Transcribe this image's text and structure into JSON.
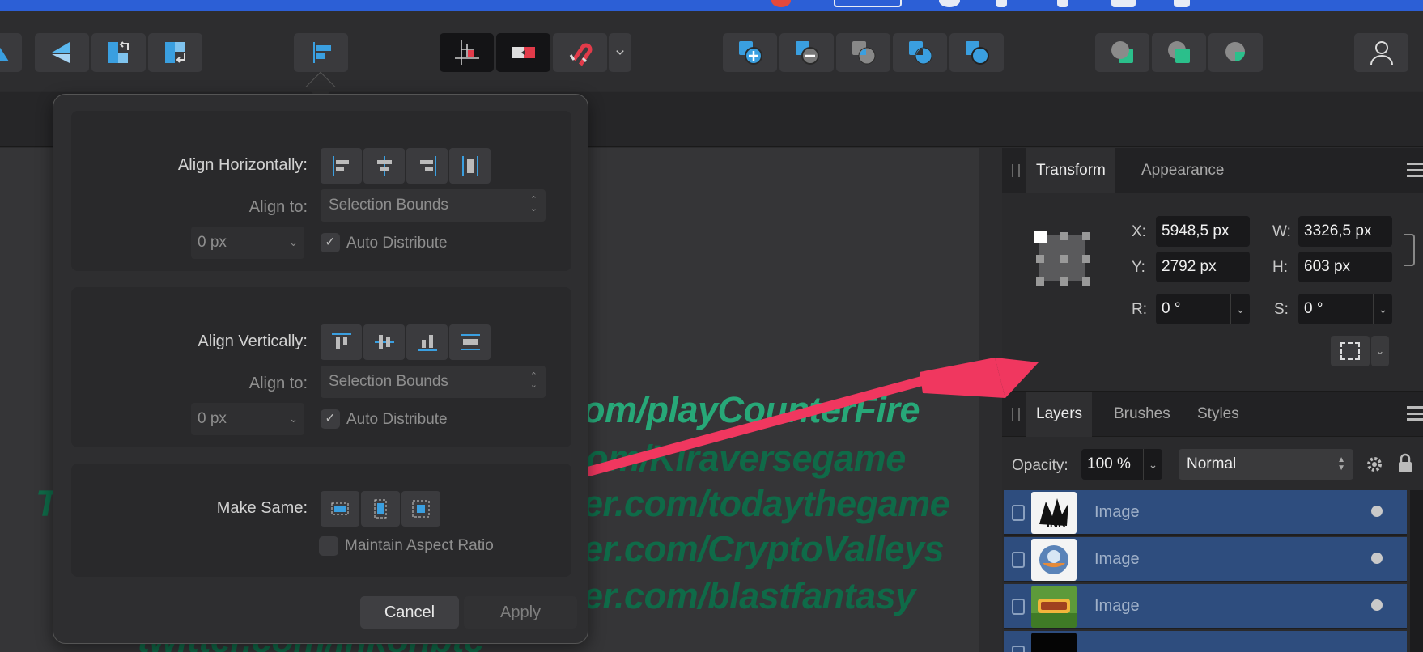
{
  "colors": {
    "accent": "#1f8fd6",
    "canvas_text_bright": "#27a878",
    "canvas_text_dim": "#0f6a48",
    "arrow": "#f0375f",
    "layer_selected": "#2e4d7e"
  },
  "toolbar": {
    "icons": [
      "flip-horizontal-icon",
      "flip-vertical-icon",
      "rotate-left-icon",
      "rotate-right-icon",
      "align-icon",
      "snap-grid-icon",
      "snap-toggle-icon",
      "magnet-icon",
      "snapping-dropdown-icon",
      "add-shape-icon",
      "subtract-shape-icon",
      "intersect-shape-icon",
      "xor-shape-icon",
      "divide-shape-icon",
      "insert-behind-icon",
      "insert-top-icon",
      "insert-inside-icon",
      "user-icon"
    ]
  },
  "canvas": {
    "lines": [
      "om/playCounterFire",
      "om/Kiraversegame",
      "T",
      "er.com/todaythegame",
      "er.com/CryptoValleys",
      "er.com/blastfantasy",
      "twitter.com/inkonbtc"
    ]
  },
  "align_popover": {
    "horizontal": {
      "label": "Align Horizontally:",
      "align_to_label": "Align to:",
      "align_to_value": "Selection Bounds",
      "spacing_value": "0 px",
      "auto_distribute_label": "Auto Distribute"
    },
    "vertical": {
      "label": "Align Vertically:",
      "align_to_label": "Align to:",
      "align_to_value": "Selection Bounds",
      "spacing_value": "0 px",
      "auto_distribute_label": "Auto Distribute"
    },
    "make_same": {
      "label": "Make Same:",
      "maintain_label": "Maintain Aspect Ratio"
    },
    "cancel_label": "Cancel",
    "apply_label": "Apply"
  },
  "transform_panel": {
    "tabs": [
      "Transform",
      "Appearance"
    ],
    "x_label": "X:",
    "x_value": "5948,5 px",
    "y_label": "Y:",
    "y_value": "2792 px",
    "w_label": "W:",
    "w_value": "3326,5 px",
    "h_label": "H:",
    "h_value": "603 px",
    "r_label": "R:",
    "r_value": "0 °",
    "s_label": "S:",
    "s_value": "0 °"
  },
  "layers_panel": {
    "tabs": [
      "Layers",
      "Brushes",
      "Styles"
    ],
    "opacity_label": "Opacity:",
    "opacity_value": "100 %",
    "blend_mode": "Normal",
    "layers": [
      {
        "name": "Image",
        "thumb": "ink-logo"
      },
      {
        "name": "Image",
        "thumb": "orb-logo"
      },
      {
        "name": "Image",
        "thumb": "crypto-valleys-logo"
      },
      {
        "name": "",
        "thumb": "dark"
      }
    ]
  }
}
